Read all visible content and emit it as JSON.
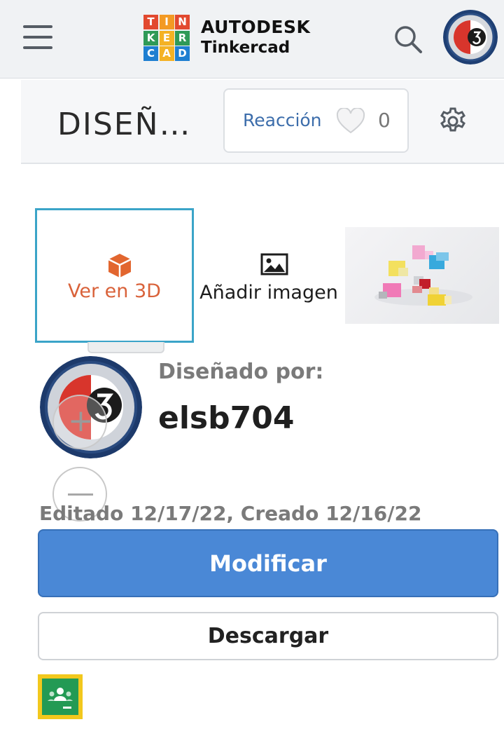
{
  "app": {
    "brand": "AUTODESK",
    "product": "Tinkercad",
    "logo_letters": [
      "T",
      "I",
      "N",
      "K",
      "E",
      "R",
      "C",
      "A",
      "D"
    ],
    "logo_colors": [
      "#e2492f",
      "#f39a24",
      "#e2492f",
      "#2f9a57",
      "#f4b224",
      "#2f9a57",
      "#1e7fd1",
      "#f4b224",
      "#1e7fd1"
    ],
    "icons": {
      "menu": "hamburger-icon",
      "search": "search-icon",
      "settings": "gear-icon",
      "reaction": "heart-icon",
      "view3d": "cube-icon",
      "add_image": "image-icon",
      "classroom": "google-classroom-icon"
    }
  },
  "design": {
    "title": "DISEÑ…",
    "reaction_label": "Reacción",
    "reaction_count": "0"
  },
  "tabs": {
    "view3d_label": "Ver en 3D",
    "add_image_label": "Añadir imagen"
  },
  "designer": {
    "designed_by_label": "Diseñado por:",
    "username": "elsb704",
    "dates": "Editado 12/17/22, Creado 12/16/22"
  },
  "actions": {
    "modify_label": "Modificar",
    "download_label": "Descargar"
  },
  "colors": {
    "accent_blue": "#4a88d6",
    "view3d_orange": "#d9623a",
    "selected_border": "#3ba4c8",
    "reaction_text": "#3c6dab"
  }
}
